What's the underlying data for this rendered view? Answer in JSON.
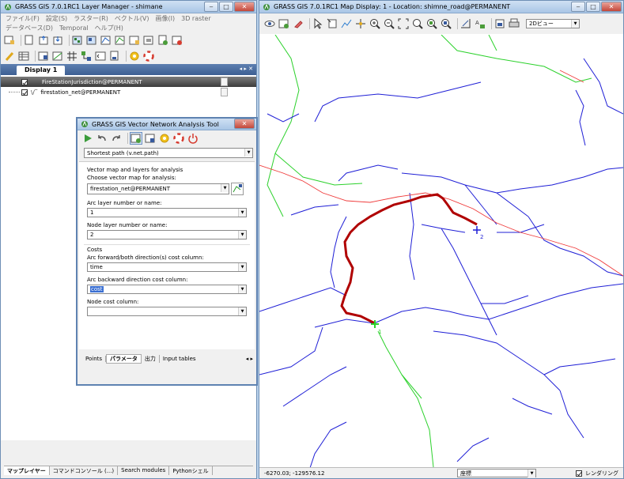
{
  "layer_manager": {
    "title": "GRASS GIS 7.0.1RC1 Layer Manager - shimane",
    "menu": [
      "ファイル(F)",
      "設定(S)",
      "ラスター(R)",
      "ベクトル(V)",
      "画像(I)",
      "3D raster",
      "データベース(D)",
      "Temporal",
      "ヘルプ(H)"
    ],
    "display_tab": "Display 1",
    "layers": [
      "FireStationJurisdiction@PERMANENT",
      "firestation_net@PERMANENT"
    ],
    "bottom_tabs": [
      "マップレイヤー",
      "コマンドコンソール (...)",
      "Search modules",
      "Pythonシェル"
    ]
  },
  "map_display": {
    "title": "GRASS GIS 7.0.1RC1 Map Display: 1  - Location: shimne_road@PERMANENT",
    "view_mode": "2Dビュー",
    "coords": "-6270.03; -129576.12",
    "coord_mode": "座標",
    "render_label": "レンダリング",
    "point_labels": [
      "1",
      "2"
    ],
    "colors": {
      "roads": "#1f1fd6",
      "boundary": "#2bd12b",
      "river": "#ef3a3a",
      "path": "#b00000"
    }
  },
  "vnet_dialog": {
    "title": "GRASS GIS Vector Network Analysis Tool",
    "analysis": "Shortest path (v.net.path)",
    "section_input": "Vector map and layers for analysis",
    "label_map": "Choose vector map for analysis:",
    "map_value": "firestation_net@PERMANENT",
    "label_arc_layer": "Arc layer number or name:",
    "arc_layer": "1",
    "label_node_layer": "Node layer number or name:",
    "node_layer": "2",
    "section_costs": "Costs",
    "label_arc_fwd": "Arc forward/both direction(s) cost column:",
    "arc_fwd": "time",
    "label_arc_bwd": "Arc backward direction cost column:",
    "arc_bwd": "cost",
    "label_node_cost": "Node cost column:",
    "node_cost": "",
    "tabs": [
      "Points",
      "パラメータ",
      "出力",
      "Input tables"
    ]
  }
}
